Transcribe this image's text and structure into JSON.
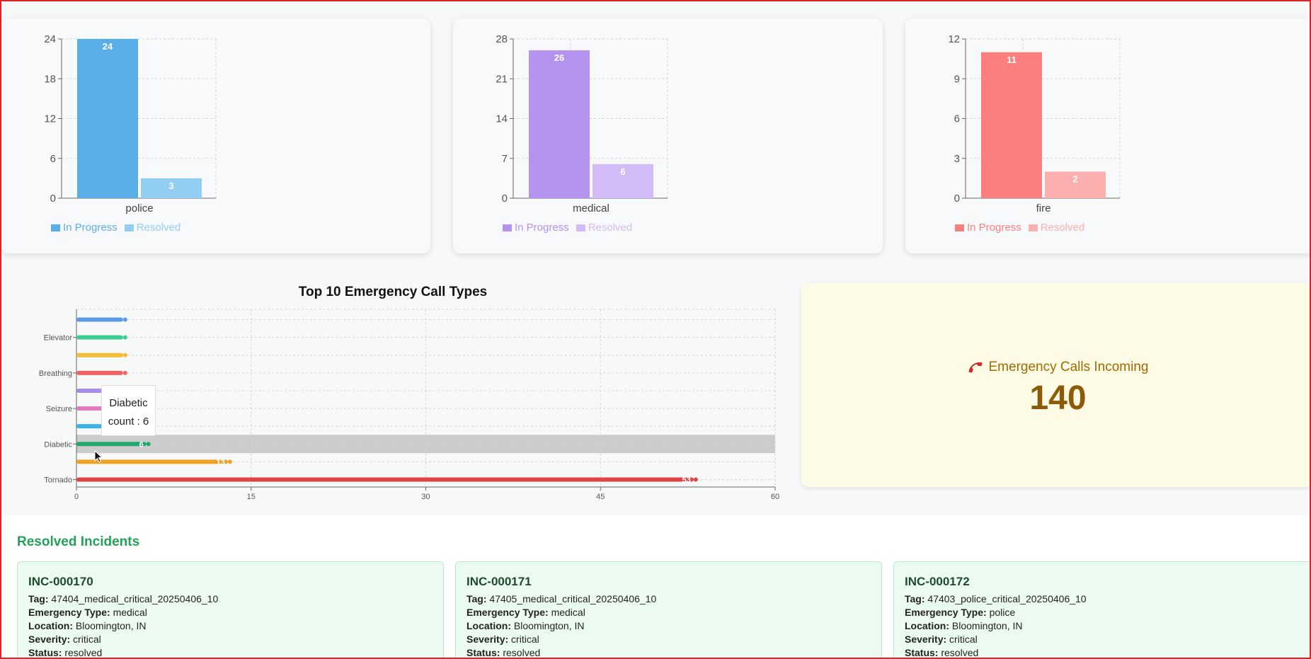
{
  "status_charts": [
    {
      "category": "police",
      "series": [
        {
          "name": "In Progress",
          "value": 24,
          "color": "#5aaee8"
        },
        {
          "name": "Resolved",
          "value": 3,
          "color": "#92cdf2"
        }
      ],
      "ticks": [
        "0",
        "6",
        "12",
        "18",
        "24"
      ],
      "ymax": 24
    },
    {
      "category": "medical",
      "series": [
        {
          "name": "In Progress",
          "value": 26,
          "color": "#b392f0"
        },
        {
          "name": "Resolved",
          "value": 6,
          "color": "#d3bbf7"
        }
      ],
      "ticks": [
        "0",
        "7",
        "14",
        "21",
        "28"
      ],
      "ymax": 28
    },
    {
      "category": "fire",
      "series": [
        {
          "name": "In Progress",
          "value": 11,
          "color": "#fc7f7f"
        },
        {
          "name": "Resolved",
          "value": 2,
          "color": "#fdaeae"
        }
      ],
      "ticks": [
        "0",
        "3",
        "6",
        "9",
        "12"
      ],
      "ymax": 12
    }
  ],
  "chart_data": [
    {
      "type": "bar",
      "categories": [
        "police"
      ],
      "series": [
        {
          "name": "In Progress",
          "values": [
            24
          ]
        },
        {
          "name": "Resolved",
          "values": [
            3
          ]
        }
      ],
      "ylim": [
        0,
        24
      ],
      "grid": true,
      "legend": "bottom-left"
    },
    {
      "type": "bar",
      "categories": [
        "medical"
      ],
      "series": [
        {
          "name": "In Progress",
          "values": [
            26
          ]
        },
        {
          "name": "Resolved",
          "values": [
            6
          ]
        }
      ],
      "ylim": [
        0,
        28
      ],
      "grid": true,
      "legend": "bottom-left"
    },
    {
      "type": "bar",
      "categories": [
        "fire"
      ],
      "series": [
        {
          "name": "In Progress",
          "values": [
            11
          ]
        },
        {
          "name": "Resolved",
          "values": [
            2
          ]
        }
      ],
      "ylim": [
        0,
        12
      ],
      "grid": true,
      "legend": "bottom-left"
    },
    {
      "type": "bar",
      "orientation": "horizontal",
      "title": "Top 10 Emergency Call Types",
      "categories": [
        "",
        "Elevator",
        "",
        "Breathing",
        "",
        "Seizure",
        "",
        "Diabetic",
        "",
        "Tornado"
      ],
      "values": [
        4,
        4,
        4,
        4,
        4,
        4,
        4,
        6,
        13,
        53
      ],
      "colors": [
        "#5b9be6",
        "#3ecc93",
        "#f4bb33",
        "#ee6464",
        "#a78ced",
        "#e37ac2",
        "#37b5e9",
        "#20a86b",
        "#eea325",
        "#e04444"
      ],
      "data_labels": [
        "",
        "",
        "",
        "",
        "",
        "",
        "",
        "6",
        "13",
        "53"
      ],
      "xlim": [
        0,
        60
      ],
      "x_ticks": [
        "0",
        "15",
        "30",
        "45",
        "60"
      ],
      "grid": true,
      "highlighted_category": "Diabetic"
    }
  ],
  "hchart": {
    "title": "Top 10 Emergency Call Types",
    "tooltip": {
      "name": "Diabetic",
      "text": "count : 6"
    }
  },
  "calls": {
    "title": "Emergency Calls Incoming",
    "value": "140",
    "icon": "phone-icon",
    "icon_color": "#d9252a"
  },
  "resolved": {
    "title": "Resolved Incidents",
    "field_labels": {
      "tag": "Tag:",
      "type": "Emergency Type:",
      "location": "Location:",
      "severity": "Severity:",
      "status": "Status:"
    },
    "incidents": [
      {
        "id": "INC-000170",
        "tag": "47404_medical_critical_20250406_10",
        "type": "medical",
        "location": "Bloomington, IN",
        "severity": "critical",
        "status": "resolved"
      },
      {
        "id": "INC-000171",
        "tag": "47405_medical_critical_20250406_10",
        "type": "medical",
        "location": "Bloomington, IN",
        "severity": "critical",
        "status": "resolved"
      },
      {
        "id": "INC-000172",
        "tag": "47403_police_critical_20250406_10",
        "type": "police",
        "location": "Bloomington, IN",
        "severity": "critical",
        "status": "resolved"
      }
    ]
  }
}
